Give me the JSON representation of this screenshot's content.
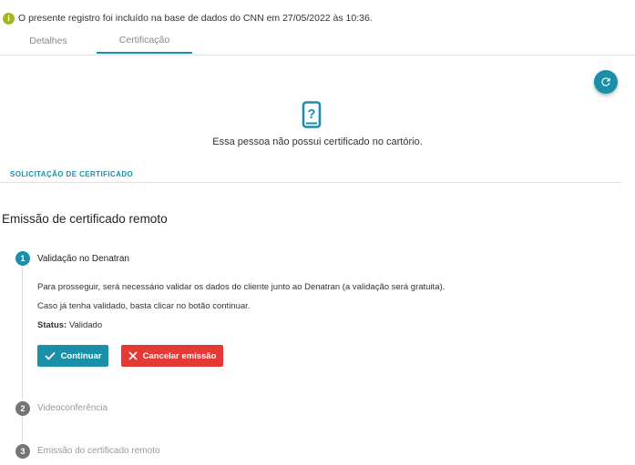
{
  "notice": {
    "text": "O presente registro foi incluído na base de dados do CNN em 27/05/2022 às 10:36."
  },
  "tabs": [
    {
      "label": "Detalhes"
    },
    {
      "label": "Certificação"
    }
  ],
  "empty_state": {
    "message": "Essa pessoa não possui certificado no cartório."
  },
  "section": {
    "label": "SOLICITAÇÃO DE CERTIFICADO"
  },
  "page": {
    "title": "Emissão de certificado remoto"
  },
  "steps": [
    {
      "number": "1",
      "title": "Validação no Denatran",
      "text1": "Para prosseguir, será necessário validar os dados do cliente junto ao Denatran (a validação será gratuita).",
      "text2": "Caso já tenha validado, basta clicar no botão continuar.",
      "status_label": "Status:",
      "status_value": "Validado"
    },
    {
      "number": "2",
      "title": "Videoconferência"
    },
    {
      "number": "3",
      "title": "Emissão do certificado remoto"
    }
  ],
  "buttons": {
    "continue": "Continuar",
    "cancel": "Cancelar emissão"
  },
  "colors": {
    "accent": "#1a8fa8",
    "danger": "#e53935",
    "info": "#a6b61f"
  },
  "icons": [
    "info-icon",
    "refresh-icon",
    "phone-question-icon",
    "check-icon",
    "close-icon"
  ]
}
